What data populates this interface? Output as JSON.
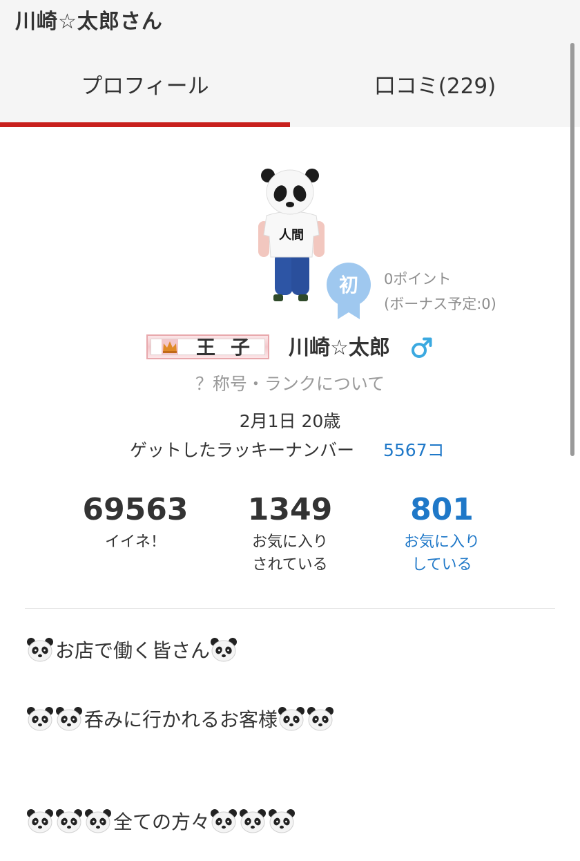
{
  "header": {
    "title": "川崎☆太郎さん"
  },
  "tabs": [
    {
      "label": "プロフィール",
      "active": true
    },
    {
      "label": "口コミ(229)",
      "active": false
    }
  ],
  "profile": {
    "badge_char": "初",
    "points": "0ポイント",
    "bonus": "(ボーナス予定:0)",
    "rank_title": "王子",
    "avatar_shirt_text": "人間",
    "name": "川崎☆太郎",
    "gender_symbol": "♂",
    "rank_link": "？称号・ランクについて",
    "birthday": "2月1日 20歳",
    "lucky_label": "ゲットしたラッキーナンバー",
    "lucky_value": "5567コ"
  },
  "stats": [
    {
      "number": "69563",
      "label1": "イイネ！",
      "label2": ""
    },
    {
      "number": "1349",
      "label1": "お気に入り",
      "label2": "されている"
    },
    {
      "number": "801",
      "label1": "お気に入り",
      "label2": "している"
    }
  ],
  "intro": {
    "line1": "お店で働く皆さん",
    "line2": "呑みに行かれるお客様",
    "line3": "全ての方々"
  },
  "colors": {
    "accent": "#c8201d",
    "link": "#1f78c8",
    "badge": "#9fc8ef"
  },
  "icons": {
    "panda": "panda-face-icon",
    "gender": "male-sign-icon",
    "crown": "crown-icon"
  }
}
